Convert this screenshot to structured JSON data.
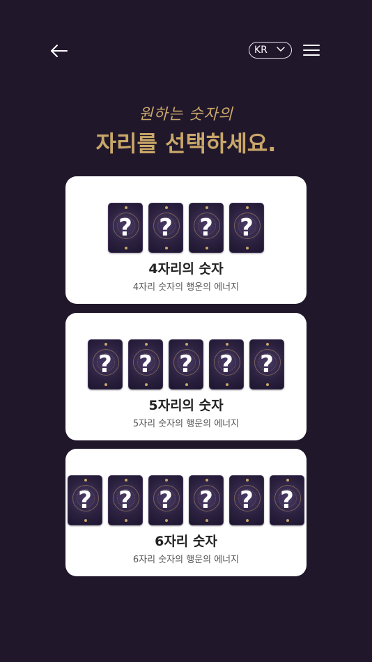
{
  "header": {
    "back_icon": "arrow-left-icon",
    "language": "KR",
    "language_icon": "chevron-down-icon",
    "menu_icon": "hamburger-menu-icon"
  },
  "headline": {
    "subtitle": "원하는 숫자의",
    "title": "자리를 선택하세요."
  },
  "options": [
    {
      "card_count": 4,
      "card_symbol": "?",
      "title": "4자리의 숫자",
      "subtitle": "4자리 숫자의 행운의 에너지"
    },
    {
      "card_count": 5,
      "card_symbol": "?",
      "title": "5자리의 숫자",
      "subtitle": "5자리 숫자의 행운의 에너지"
    },
    {
      "card_count": 6,
      "card_symbol": "?",
      "title": "6자리 숫자",
      "subtitle": "6자리 숫자의 행운의 에너지"
    }
  ],
  "colors": {
    "background": "#20172b",
    "accent_gold": "#c9a769",
    "card_bg": "#ffffff"
  }
}
